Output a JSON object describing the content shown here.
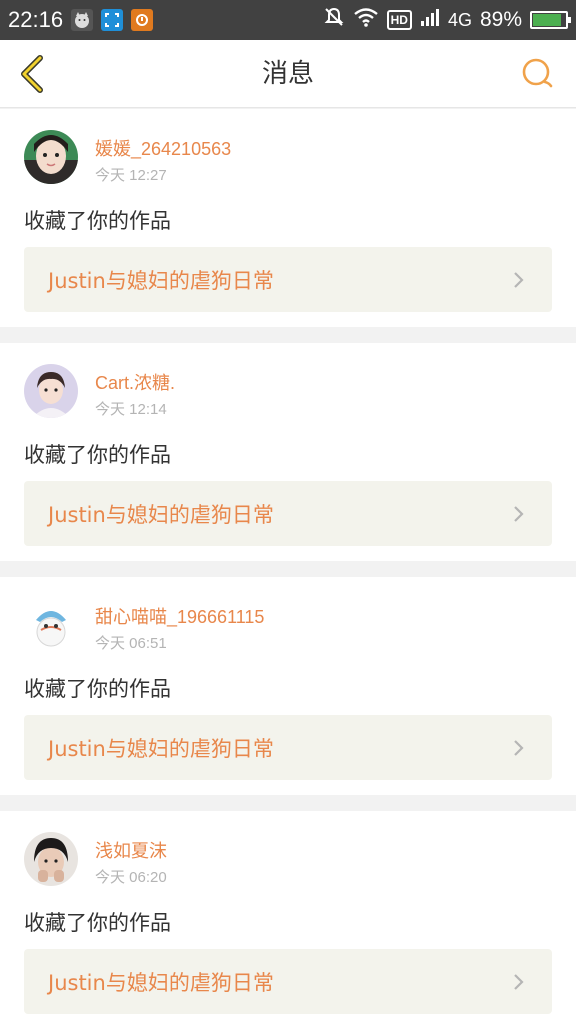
{
  "status_bar": {
    "time": "22:16",
    "network": "4G",
    "hd": "HD",
    "battery_percent": "89%",
    "battery_level": 0.89,
    "icons": [
      "cat-app-icon",
      "screenshot-icon",
      "camera-app-icon",
      "mute-bell-icon",
      "wifi-icon",
      "signal-icon"
    ]
  },
  "header": {
    "title": "消息",
    "back_icon": "chevron-left-icon",
    "search_icon": "search-icon",
    "accent": "#f0a24a"
  },
  "messages": [
    {
      "user": "媛媛_264210563",
      "time": "今天 12:27",
      "action": "收藏了你的作品",
      "work": "Justin与媳妇的虐狗日常"
    },
    {
      "user": "Cart.浓糖.",
      "time": "今天 12:14",
      "action": "收藏了你的作品",
      "work": "Justin与媳妇的虐狗日常"
    },
    {
      "user": "甜心喵喵_196661115",
      "time": "今天 06:51",
      "action": "收藏了你的作品",
      "work": "Justin与媳妇的虐狗日常"
    },
    {
      "user": "浅如夏沫",
      "time": "今天 06:20",
      "action": "收藏了你的作品",
      "work": "Justin与媳妇的虐狗日常"
    }
  ],
  "colors": {
    "username": "#e8874b",
    "link_bg": "#f3f3ec",
    "status_bg": "#414141"
  }
}
